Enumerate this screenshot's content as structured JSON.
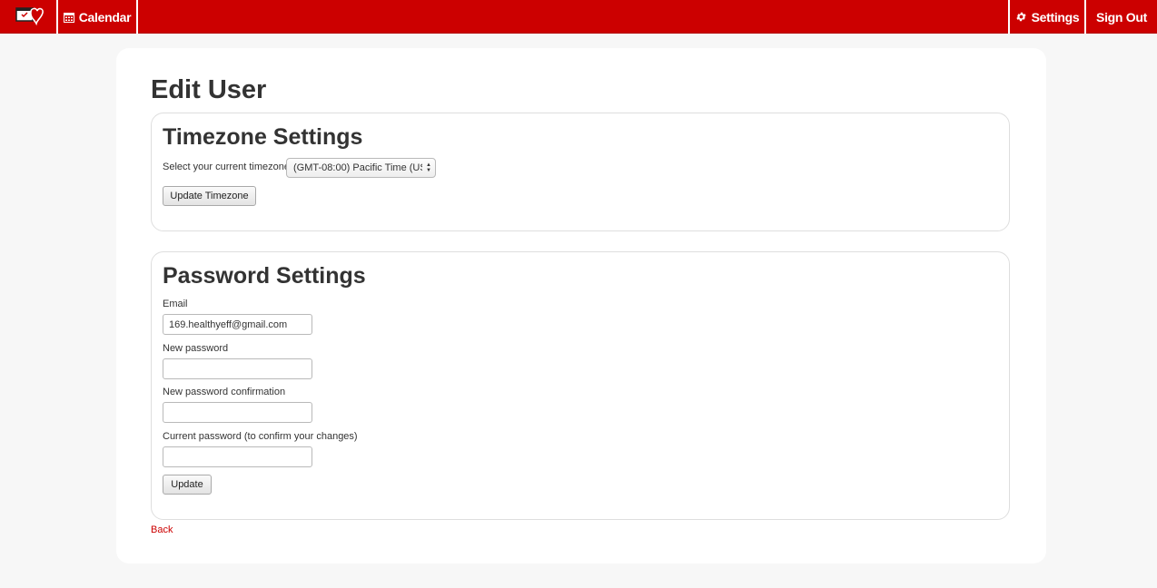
{
  "navbar": {
    "brand_icon": "heart-calendar-logo",
    "calendar_label": "Calendar",
    "calendar_icon": "calendar-icon",
    "settings_label": "Settings",
    "settings_icon": "gear-icon",
    "signout_label": "Sign Out",
    "color": "#cc0000"
  },
  "page": {
    "title": "Edit User",
    "back_label": "Back"
  },
  "timezone": {
    "heading": "Timezone Settings",
    "select_label": "Select your current timezone",
    "selected_value": "(GMT-08:00) Pacific Time (US",
    "button_label": "Update Timezone"
  },
  "password": {
    "heading": "Password Settings",
    "email_label": "Email",
    "email_value": "169.healthyeff@gmail.com",
    "new_password_label": "New password",
    "new_password_value": "",
    "confirm_label": "New password confirmation",
    "confirm_value": "",
    "current_label": "Current password (to confirm your changes)",
    "current_value": "",
    "button_label": "Update"
  }
}
